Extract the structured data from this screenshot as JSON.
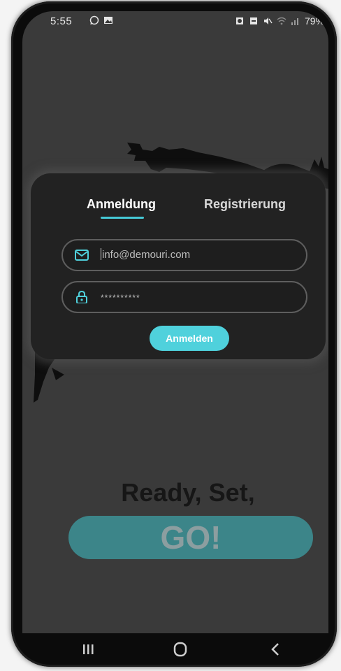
{
  "status_bar": {
    "time": "5:55",
    "battery": "79%",
    "icons": [
      "whatsapp-icon",
      "gallery-icon",
      "alarm-icon",
      "dnd-icon",
      "mute-icon",
      "wifi-icon",
      "signal-icon"
    ]
  },
  "login_card": {
    "tabs": [
      {
        "label": "Anmeldung",
        "active": true
      },
      {
        "label": "Registrierung",
        "active": false
      }
    ],
    "email": {
      "value": "info@demouri.com",
      "icon": "mail-icon"
    },
    "password": {
      "value": "**********",
      "icon": "lock-icon"
    },
    "submit_label": "Anmelden"
  },
  "hero": {
    "headline": "Ready, Set,",
    "cta_label": "GO!"
  },
  "nav_bar": {
    "buttons": [
      "recents-icon",
      "home-icon",
      "back-icon"
    ]
  },
  "colors": {
    "accent": "#4fd1dc",
    "card_bg": "#222222",
    "screen_bg": "#3a3a3a",
    "cta_bg": "#3c8589"
  }
}
